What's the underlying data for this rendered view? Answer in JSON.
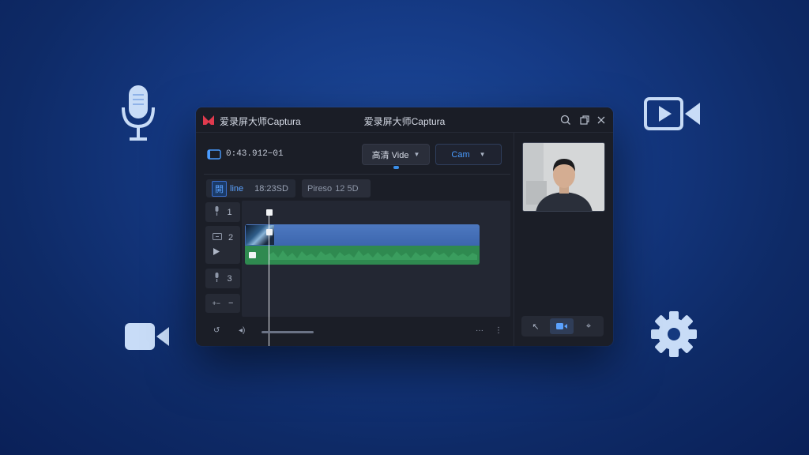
{
  "window": {
    "app_name": "爱录屏大师Captura",
    "title": "爱录屏大师Captura"
  },
  "toolbar": {
    "timecode": "0:43.912−01",
    "quality_label": "高清 Vide",
    "camera_label": "Cam",
    "quality_dropdown_icon": "chevron-down-icon",
    "camera_dropdown_icon": "chevron-down-icon"
  },
  "tabs": [
    {
      "highlight": "開",
      "label": "line",
      "value": "18:23SD"
    },
    {
      "label": "Pireso",
      "value": "12 5D"
    }
  ],
  "tracks": [
    {
      "number": "1",
      "icon": "mic-icon"
    },
    {
      "number": "2",
      "icon": "screen-icon"
    },
    {
      "number": "3",
      "icon": "mic-icon"
    }
  ],
  "track_controls": {
    "left": "+−",
    "right": "−"
  },
  "bottom_bar": {
    "icons": [
      "undo-icon",
      "volume-icon",
      "more-icon",
      "kebab-icon"
    ]
  },
  "camera_tools": {
    "icons": [
      "pointer-icon",
      "camera-icon",
      "crosshair-icon"
    ],
    "active_index": 1
  },
  "colors": {
    "accent_blue": "#4a9cff",
    "clip_video": "#4d78c0",
    "clip_audio": "#2f8a50",
    "logo_red": "#e03a4e"
  }
}
